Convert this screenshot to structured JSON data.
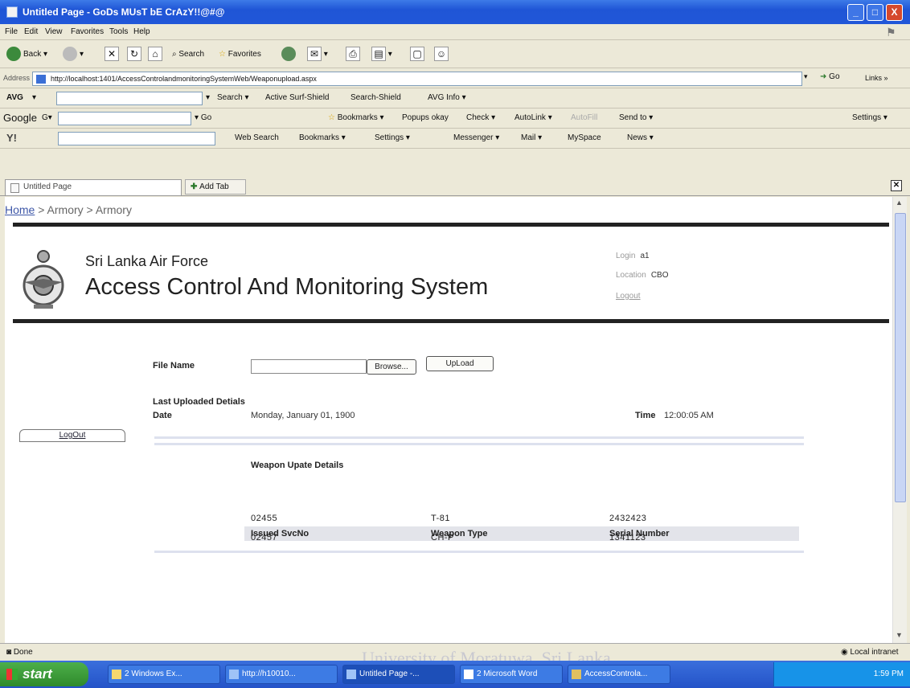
{
  "window": {
    "title": "Untitled Page - GoDs MUsT bE CrAzY!!@#@",
    "minimize": "_",
    "maximize": "□",
    "close": "X"
  },
  "menu": [
    "File",
    "Edit",
    "View",
    "Favorites",
    "Tools",
    "Help"
  ],
  "toolbar": {
    "back": "Back",
    "search": "Search",
    "favorites": "Favorites"
  },
  "address": {
    "label": "Address",
    "url": "http://localhost:1401/AccessControlandmonitoringSystemWeb/Weaponupload.aspx",
    "go": "Go",
    "links": "Links"
  },
  "avg_bar": {
    "brand": "AVG",
    "search": "Search",
    "active_surf": "Active Surf-Shield",
    "search_shield": "Search-Shield",
    "avg_info": "AVG Info"
  },
  "google_bar": {
    "brand": "Google",
    "go": "Go",
    "bookmarks": "Bookmarks",
    "popups": "Popups okay",
    "check": "Check",
    "autolink": "AutoLink",
    "autofill": "AutoFill",
    "send_to": "Send to",
    "settings": "Settings"
  },
  "yahoo_bar": {
    "brand": "Y!",
    "web_search": "Web Search",
    "bookmarks": "Bookmarks",
    "settings": "Settings",
    "messenger": "Messenger",
    "mail": "Mail",
    "myspace": "MySpace",
    "news": "News"
  },
  "tabs": {
    "current": "Untitled Page",
    "add": "Add Tab"
  },
  "page": {
    "breadcrumb_home": "Home",
    "breadcrumb_rest": " > Armory > Armory",
    "org_name": "Sri Lanka Air Force",
    "system_name": "Access Control And Monitoring System",
    "login_label": "Login",
    "login_value": "a1",
    "location_label": "Location",
    "location_value": "CBO",
    "logout_link": "Logout",
    "sidebar_logout": "LogOut",
    "file_name_label": "File Name",
    "browse": "Browse...",
    "upload": "UpLoad",
    "last_uploaded": "Last Uploaded Detials",
    "date_label": "Date",
    "date_value": "Monday, January 01, 1900",
    "time_label": "Time",
    "time_value": "12:00:05 AM",
    "weapon_update": "Weapon Upate Details",
    "table": {
      "headers": [
        "Issued SvcNo",
        "Weapon Type",
        "Serial Number"
      ],
      "rows": [
        [
          "02455",
          "T-81",
          "2432423"
        ],
        [
          "02457",
          "CH-P",
          "1341123"
        ]
      ]
    }
  },
  "status": {
    "left": "Done",
    "right": "Local intranet"
  },
  "taskbar": {
    "start": "start",
    "items": [
      "2 Windows Ex...",
      "http://h10010...",
      "Untitled Page -...",
      "2 Microsoft Word",
      "AccessControla..."
    ],
    "clock": "1:59 PM"
  },
  "watermark": "University of Moratuwa, Sri Lanka."
}
